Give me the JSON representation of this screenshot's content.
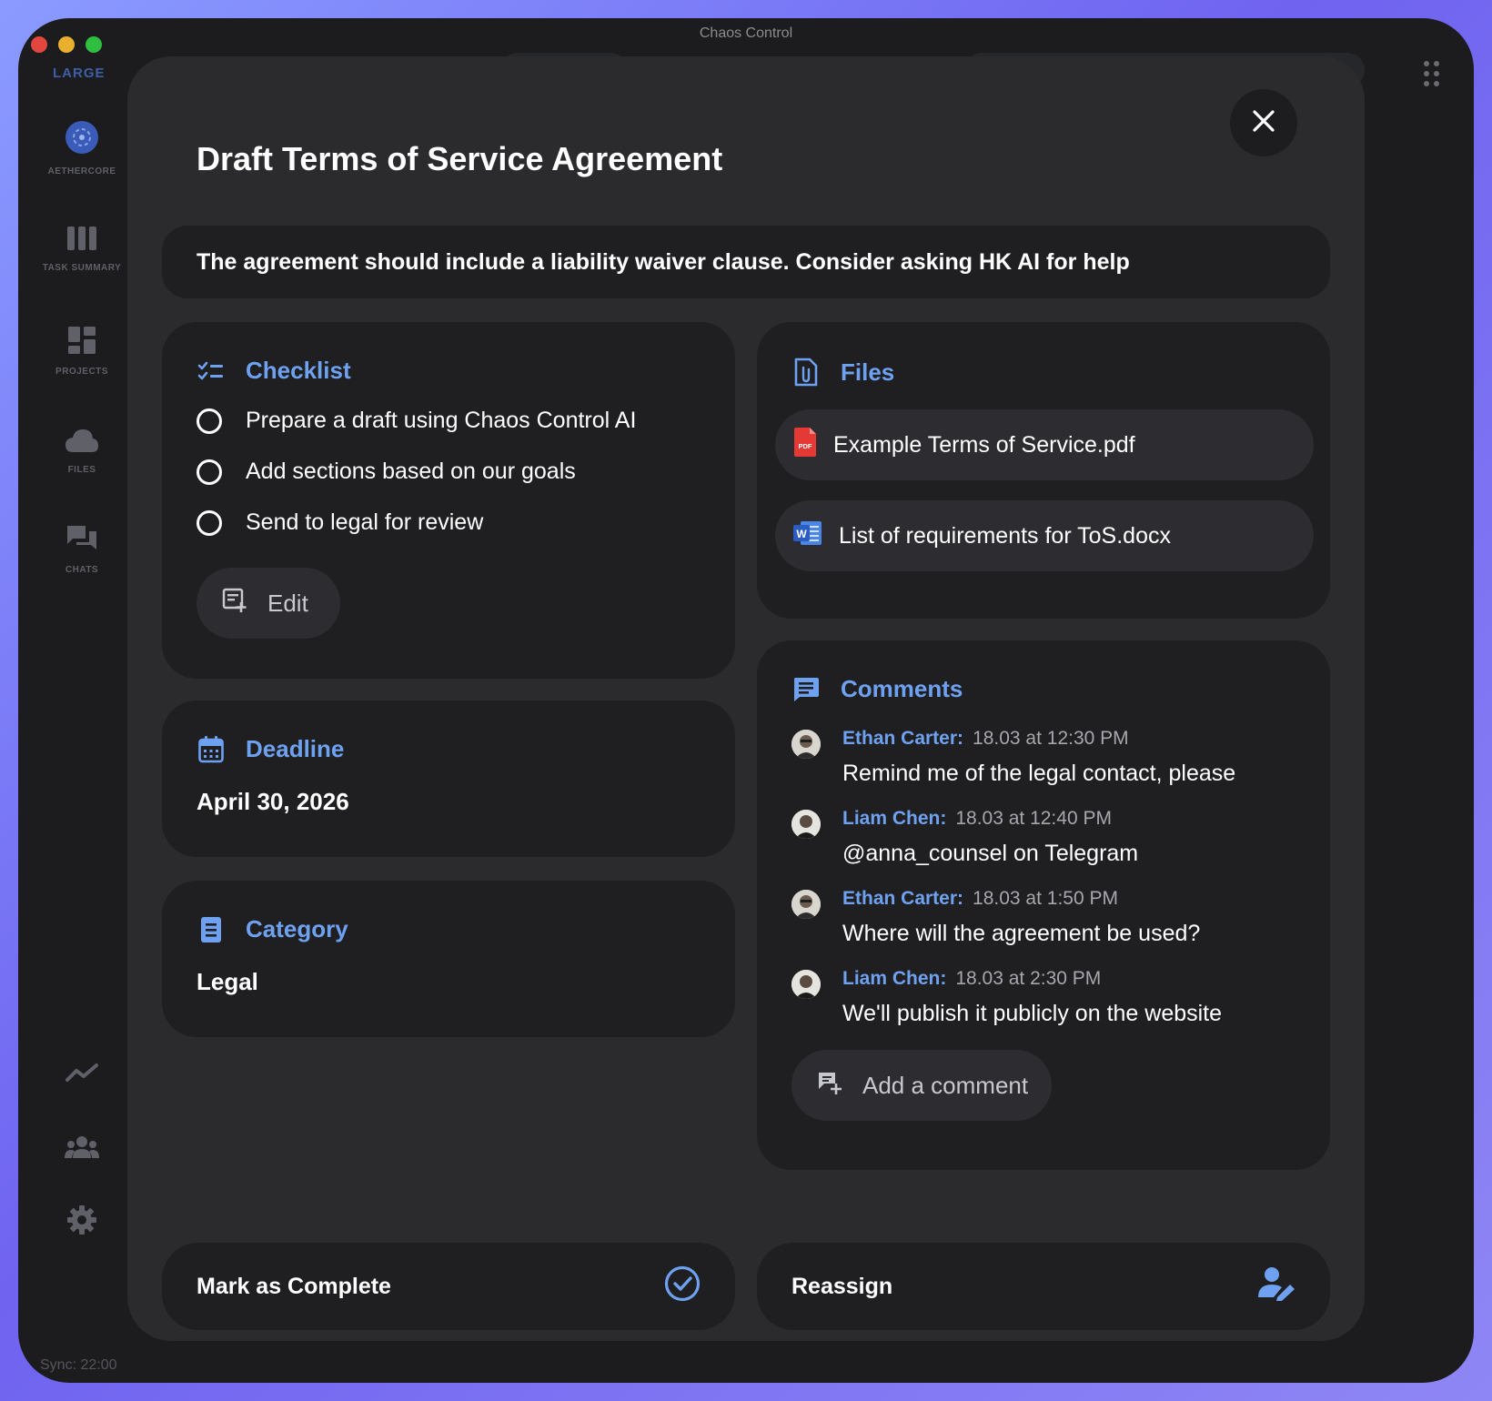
{
  "window": {
    "title": "Chaos Control"
  },
  "sidebar": {
    "size_label": "LARGE",
    "workspace": {
      "label": "AETHERCORE",
      "icon": "workspace-logo-icon"
    },
    "items": [
      {
        "label": "TASK SUMMARY",
        "icon": "columns-icon"
      },
      {
        "label": "PROJECTS",
        "icon": "dashboard-icon"
      },
      {
        "label": "FILES",
        "icon": "cloud-icon"
      },
      {
        "label": "CHATS",
        "icon": "chat-bubbles-icon"
      }
    ],
    "bottom_icons": [
      "analytics-icon",
      "team-icon",
      "settings-icon"
    ],
    "sync": "Sync: 22:00"
  },
  "modal": {
    "title": "Draft Terms of Service Agreement",
    "description": "The agreement should include a liability waiver clause. Consider asking HK AI for help",
    "checklist": {
      "title": "Checklist",
      "items": [
        {
          "label": "Prepare a draft using Chaos Control AI",
          "checked": false
        },
        {
          "label": "Add sections based on our goals",
          "checked": false
        },
        {
          "label": "Send to legal for review",
          "checked": false
        }
      ],
      "edit_label": "Edit"
    },
    "deadline": {
      "title": "Deadline",
      "value": "April 30, 2026"
    },
    "category": {
      "title": "Category",
      "value": "Legal"
    },
    "files": {
      "title": "Files",
      "items": [
        {
          "name": "Example Terms of Service.pdf",
          "type": "pdf",
          "icon": "pdf-file-icon"
        },
        {
          "name": "List of requirements for ToS.docx",
          "type": "docx",
          "icon": "word-file-icon"
        }
      ]
    },
    "comments": {
      "title": "Comments",
      "items": [
        {
          "author": "Ethan Carter:",
          "time": "18.03 at 12:30 PM",
          "text": "Remind me of the legal contact, please"
        },
        {
          "author": "Liam Chen:",
          "time": "18.03 at 12:40 PM",
          "text": "@anna_counsel on Telegram"
        },
        {
          "author": "Ethan Carter:",
          "time": "18.03 at 1:50 PM",
          "text": "Where will the agreement be used?"
        },
        {
          "author": "Liam Chen:",
          "time": "18.03 at 2:30 PM",
          "text": "We'll publish it publicly on the website"
        }
      ],
      "add_label": "Add a comment"
    },
    "actions": {
      "complete_label": "Mark as Complete",
      "reassign_label": "Reassign"
    }
  },
  "colors": {
    "accent": "#6ea2f0",
    "background": "#1c1c1e",
    "modal": "#2b2b2e",
    "card": "#1f1f22",
    "pdf": "#e53935",
    "word": "#2b5cc4"
  }
}
